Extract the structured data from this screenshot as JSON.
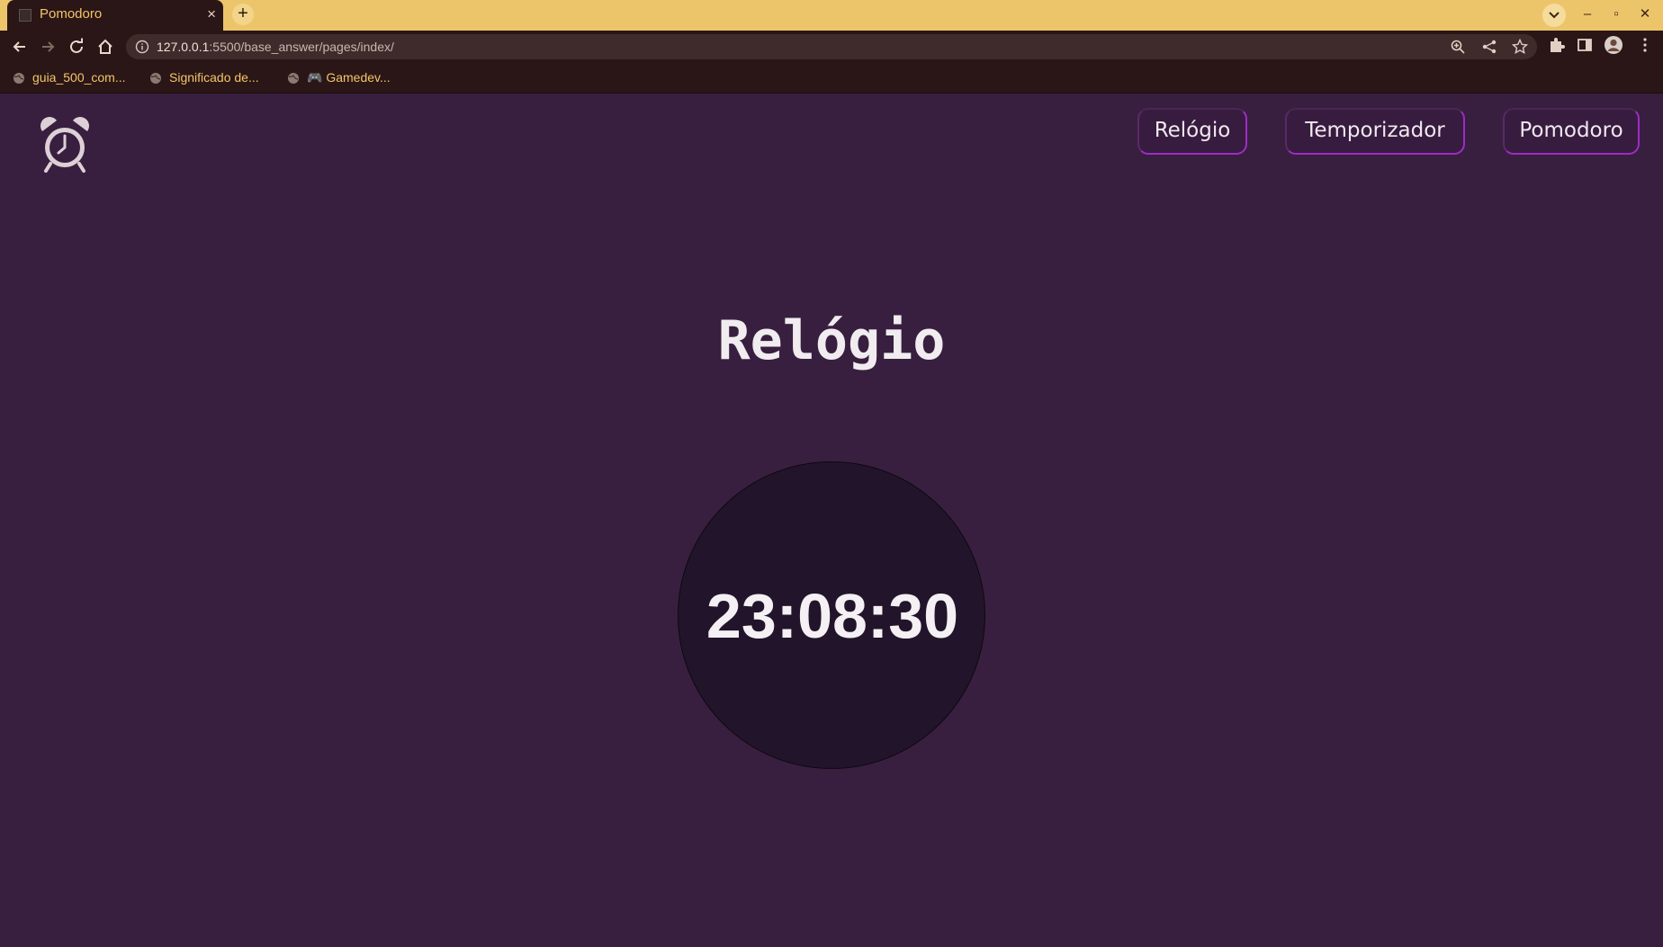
{
  "browser": {
    "tab_title": "Pomodoro",
    "tab_close": "×",
    "new_tab": "+",
    "url_host": "127.0.0.1",
    "url_rest": ":5500/base_answer/pages/index/",
    "bookmarks": [
      {
        "label": "guia_500_com..."
      },
      {
        "label": "Significado de..."
      },
      {
        "label": "🎮 Gamedev..."
      }
    ],
    "window_controls": {
      "minimize": "–",
      "restore": "▫",
      "close": "✕"
    }
  },
  "nav": {
    "items": [
      {
        "label": "Relógio"
      },
      {
        "label": "Temporizador"
      },
      {
        "label": "Pomodoro"
      }
    ]
  },
  "main": {
    "title": "Relógio",
    "time": "23:08:30"
  },
  "colors": {
    "page_bg": "#381f3f",
    "nav_border": "#9f2bc6",
    "clock_bg": "#22142a",
    "tabbar_bg": "#ecc56a"
  }
}
